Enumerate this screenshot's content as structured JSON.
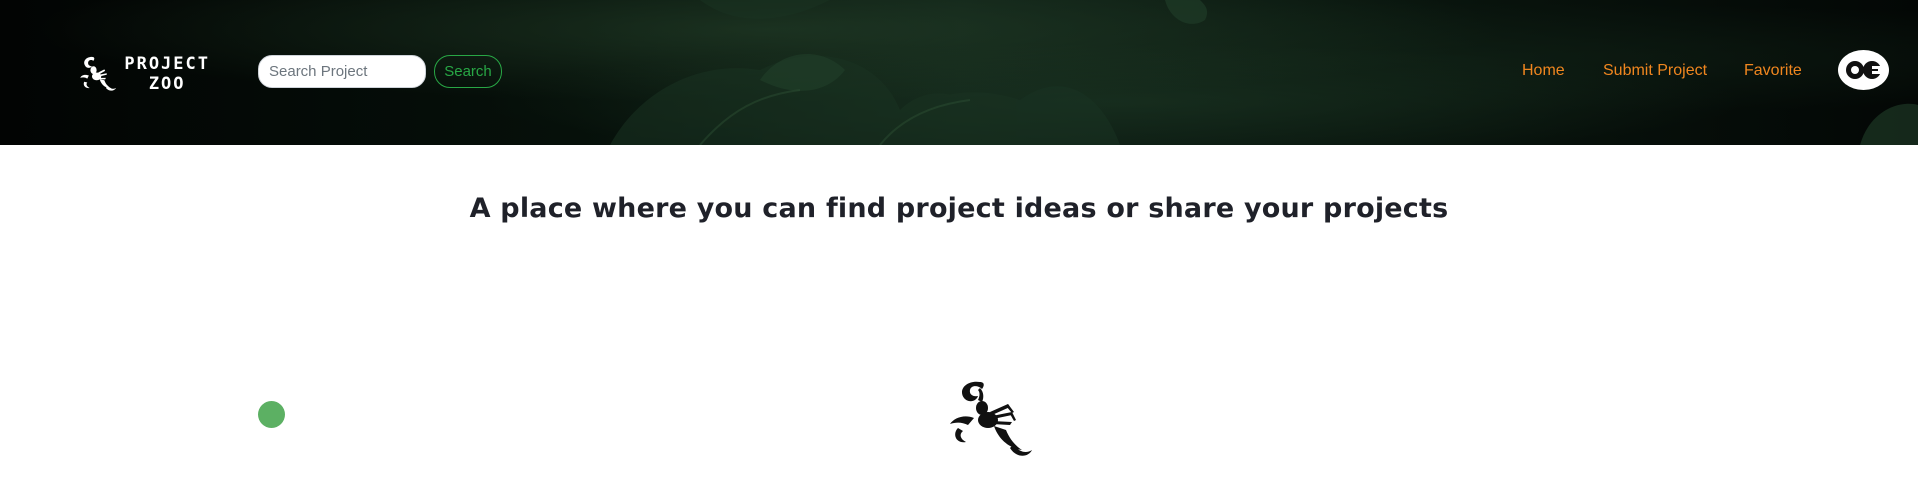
{
  "navbar": {
    "brand": {
      "line1": "PROJECT",
      "line2": "ZOO",
      "icon": "scorpion-icon"
    },
    "search": {
      "placeholder": "Search Project",
      "value": "",
      "button_label": "Search"
    },
    "links": [
      {
        "label": "Home"
      },
      {
        "label": "Submit Project"
      },
      {
        "label": "Favorite"
      }
    ],
    "avatar": {
      "icon": "profile-logo-icon"
    }
  },
  "main": {
    "headline": "A place where you can find project ideas or share your projects",
    "indicator_icon": "green-dot-icon",
    "loader_icon": "scorpion-icon"
  },
  "colors": {
    "nav_link": "#f0861f",
    "search_accent": "#28a745",
    "indicator": "#5cb063",
    "headline": "#1f2129"
  }
}
